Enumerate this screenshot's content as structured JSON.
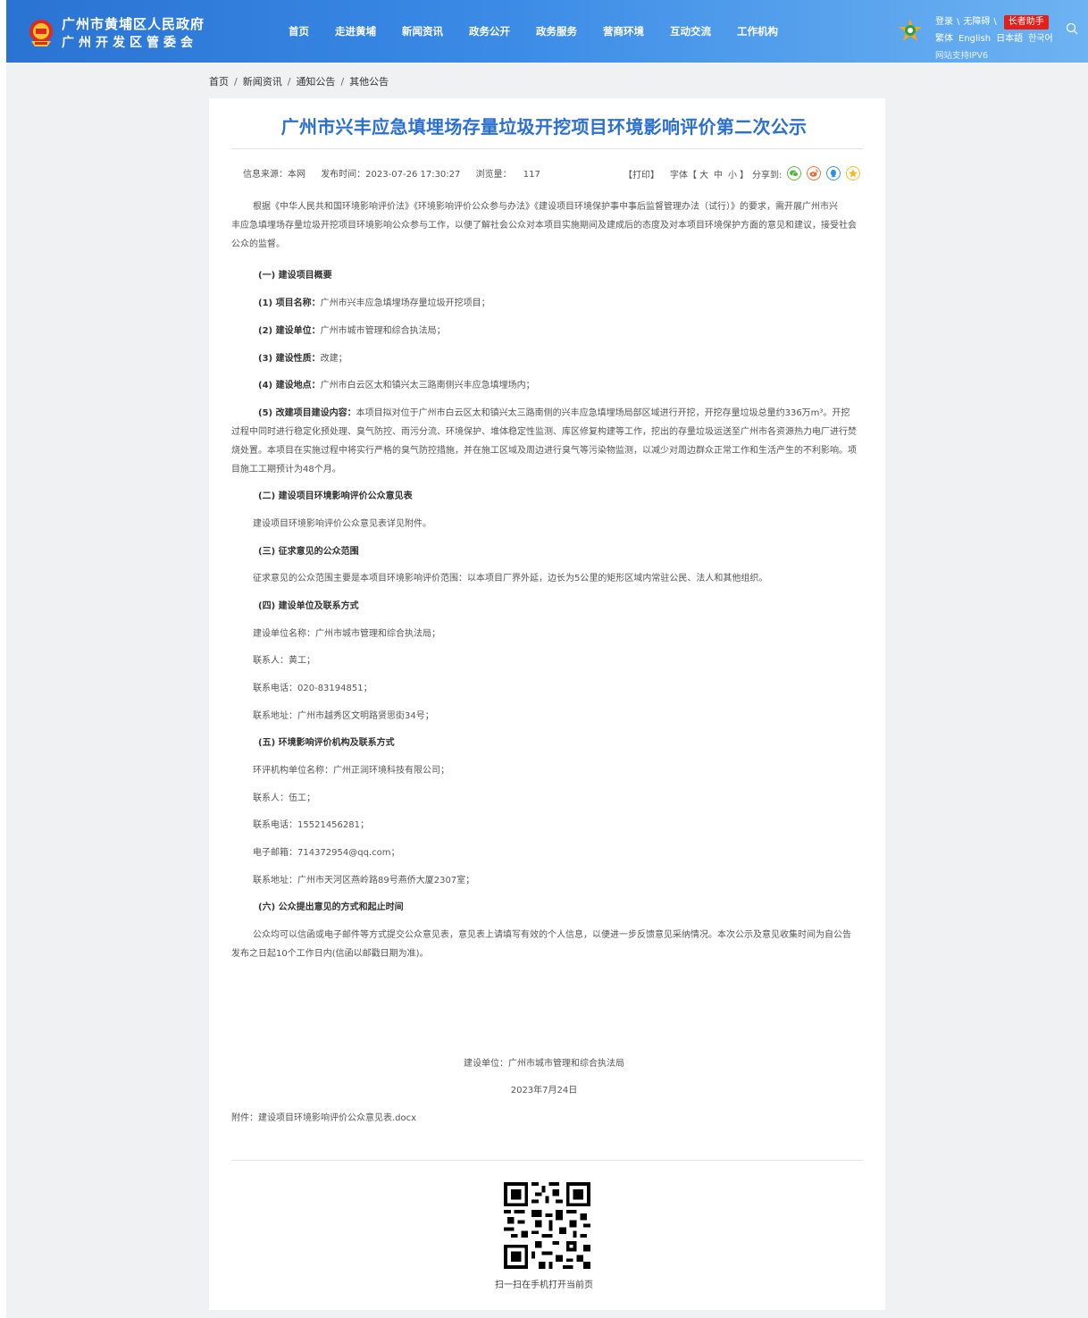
{
  "header": {
    "site_name_line1": "广州市黄埔区人民政府",
    "site_name_line2": "广州开发区管委会",
    "nav": [
      "首页",
      "走进黄埔",
      "新闻资讯",
      "政务公开",
      "政务服务",
      "营商环境",
      "互动交流",
      "工作机构"
    ],
    "login": "登录",
    "accessibility": "无障碍",
    "elder_mode": "长者助手",
    "languages": [
      "繁体",
      "English",
      "日本語",
      "한국어"
    ],
    "ipv6": "网站支持IPV6"
  },
  "breadcrumb": [
    "首页",
    "新闻资讯",
    "通知公告",
    "其他公告"
  ],
  "article": {
    "title": "广州市兴丰应急填埋场存量垃圾开挖项目环境影响评价第二次公示",
    "source": "信息来源：本网",
    "publish_time": "发布时间：2023-07-26 17:30:27",
    "views_label": "浏览量：",
    "views": "117",
    "print": "【打印】",
    "font_label": "字体【",
    "font_large": "大",
    "font_medium": "中",
    "font_small": "小",
    "font_close": "】",
    "share_label": "分享到:",
    "intro_line1": "根据《中华人民共和国环境影响评价法》《环境影响评价公众参与办法》《建设项目环境保护事中事后监督管理办法（试行）》的要求，需开展广州市兴",
    "intro_line2": "丰应急填埋场存量垃圾开挖项目环境影响公众参与工作，以便了解社会公众对本项目实施期间及建成后的态度及对本项目环境保护方面的意见和建议，接受社会",
    "intro_line3": "公众的监督。",
    "s1_heading": "(一) 建设项目概要",
    "s1_item1_label": "(1) 项目名称：",
    "s1_item1_value": "广州市兴丰应急填埋场存量垃圾开挖项目；",
    "s1_item2_label": "(2) 建设单位：",
    "s1_item2_value": "广州市城市管理和综合执法局；",
    "s1_item3_label": "(3) 建设性质：",
    "s1_item3_value": "改建；",
    "s1_item4_label": "(4) 建设地点：",
    "s1_item4_value": "广州市白云区太和镇兴太三路南侧兴丰应急填埋场内；",
    "s1_item5_label": "(5) 改建项目建设内容：",
    "s1_item5_line1": "本项目拟对位于广州市白云区太和镇兴太三路南侧的兴丰应急填埋场局部区域进行开挖，开挖存量垃圾总量约336万m³。开挖",
    "s1_item5_line2": "过程中同时进行稳定化预处理、臭气防控、雨污分流、环境保护、堆体稳定性监测、库区修复构建等工作，挖出的存量垃圾运送至广州市各资源热力电厂进行焚",
    "s1_item5_line3": "烧处置。本项目在实施过程中将实行严格的臭气防控措施，并在施工区域及周边进行臭气等污染物监测，以减少对周边群众正常工作和生活产生的不利影响。项",
    "s1_item5_line4": "目施工工期预计为48个月。",
    "s2_heading": "(二) 建设项目环境影响评价公众意见表",
    "s2_text": "建设项目环境影响评价公众意见表详见附件。",
    "s3_heading": "(三) 征求意见的公众范围",
    "s3_text": "征求意见的公众范围主要是本项目环境影响评价范围：以本项目厂界外延，边长为5公里的矩形区域内常驻公民、法人和其他组织。",
    "s4_heading": "(四) 建设单位及联系方式",
    "s4_unit": "建设单位名称：广州市城市管理和综合执法局；",
    "s4_contact": "联系人：黄工；",
    "s4_phone": "联系电话：020-83194851；",
    "s4_address": "联系地址：广州市越秀区文明路贤思街34号；",
    "s5_heading": "(五) 环境影响评价机构及联系方式",
    "s5_unit": "环评机构单位名称：广州正润环境科技有限公司；",
    "s5_contact": "联系人：伍工；",
    "s5_phone": "联系电话：15521456281；",
    "s5_email": "电子邮箱：714372954@qq.com；",
    "s5_address": "联系地址：广州市天河区燕岭路89号燕侨大厦2307室；",
    "s6_heading": "(六) 公众提出意见的方式和起止时间",
    "s6_line1": "公众均可以信函或电子邮件等方式提交公众意见表，意见表上请填写有效的个人信息，以便进一步反馈意见采纳情况。本次公示及意见收集时间为自公告",
    "s6_line2": "发布之日起10个工作日内(信函以邮戳日期为准)。",
    "sign_unit": "建设单位：广州市城市管理和综合执法局",
    "sign_date": "2023年7月24日",
    "attachment_label": "附件：",
    "attachment_file": "建设项目环境影响评价公众意见表.docx",
    "qr_caption": "扫一扫在手机打开当前页"
  },
  "colors": {
    "title": "#2b6fd1",
    "header_start": "#2a73d3",
    "header_end": "#6eb3f2",
    "elder_btn": "#e2211c"
  },
  "icons": [
    "national-emblem-icon",
    "mascot-icon",
    "search-icon",
    "wechat-icon",
    "weibo-icon",
    "qq-icon",
    "qzone-icon",
    "qr-code"
  ]
}
